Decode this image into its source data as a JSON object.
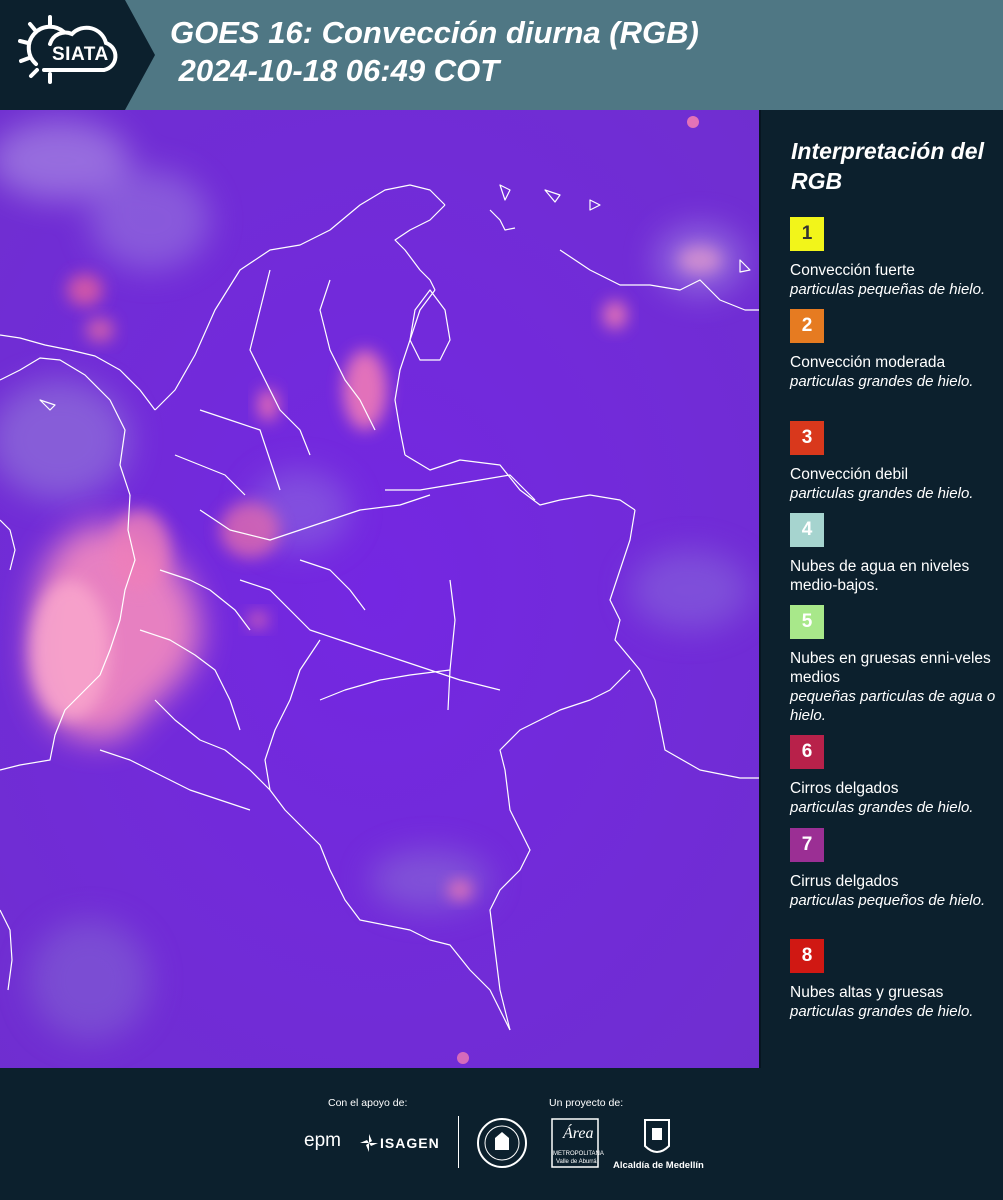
{
  "header": {
    "logo_text": "SIATA",
    "title": "GOES 16: Convección diurna (RGB)\n 2024-10-18 06:49 COT"
  },
  "legend": {
    "title": "Interpretación del RGB",
    "items": [
      {
        "num": "1",
        "color": "#f2f51a",
        "num_color": "#333333",
        "label": "Convección fuerte",
        "sub": "particulas pequeñas de hielo."
      },
      {
        "num": "2",
        "color": "#e67b21",
        "num_color": "#ffffff",
        "label": "Convección moderada",
        "sub": "particulas grandes de hielo."
      },
      {
        "num": "3",
        "color": "#d9381c",
        "num_color": "#ffffff",
        "label": "Convección debil",
        "sub": "particulas grandes de hielo."
      },
      {
        "num": "4",
        "color": "#a6d4cf",
        "num_color": "#ffffff",
        "label": "Nubes de agua en niveles medio-bajos.",
        "sub": ""
      },
      {
        "num": "5",
        "color": "#a8e88a",
        "num_color": "#ffffff",
        "label": "Nubes en gruesas enni-veles medios",
        "sub": "pequeñas particulas de agua o hielo."
      },
      {
        "num": "6",
        "color": "#b8214a",
        "num_color": "#ffffff",
        "label": "Cirros delgados",
        "sub": "particulas grandes de hielo."
      },
      {
        "num": "7",
        "color": "#9b2f94",
        "num_color": "#ffffff",
        "label": "Cirrus delgados",
        "sub": "particulas pequeños de hielo."
      },
      {
        "num": "8",
        "color": "#d01813",
        "num_color": "#ffffff",
        "label": "Nubes altas y gruesas",
        "sub": "particulas grandes de hielo."
      }
    ]
  },
  "footer": {
    "support_label": "Con el apoyo de:",
    "project_label": "Un proyecto de:",
    "epm": "epm",
    "isagen": "ISAGEN",
    "area_script": "Área",
    "area_sub1": "METROPOLITANA",
    "area_sub2": "Valle de Aburrá",
    "alcaldia": "Alcaldía de Medellín"
  },
  "colors": {
    "map_base": "#7425e0",
    "convection_pink": "#f07ab4",
    "header_bg": "#4f7784",
    "panel_bg": "#0c202d"
  }
}
